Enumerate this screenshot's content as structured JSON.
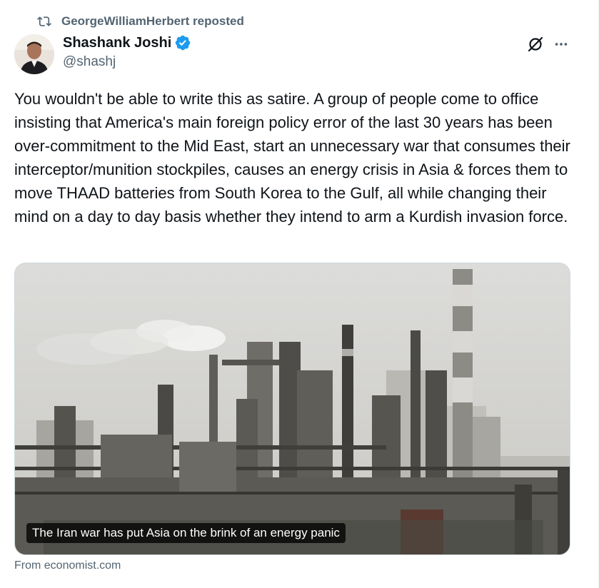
{
  "repost": {
    "label": "GeorgeWilliamHerbert reposted",
    "icon": "repost-icon"
  },
  "author": {
    "name": "Shashank Joshi",
    "handle": "@shashj",
    "verified": true,
    "verified_color": "#1d9bf0"
  },
  "actions": {
    "grok_icon": "grok-icon",
    "more_icon": "more-icon"
  },
  "tweet": {
    "text": "You wouldn't be able to write this as satire. A group of people come to office insisting that America's main foreign policy error of the last 30 years has been over-commitment to the Mid East, start an unnecessary war that consumes their interceptor/munition stockpiles, causes an energy crisis in Asia & forces them to move THAAD batteries from South Korea to the Gulf, all while changing their mind on a day to day basis whether they intend to arm a Kurdish invasion force."
  },
  "card": {
    "image_alt": "Industrial refinery with smokestacks",
    "caption": "The Iran war has put Asia on the brink of an energy panic",
    "source": "From economist.com"
  },
  "colors": {
    "text": "#0f1419",
    "secondary": "#536471",
    "accent": "#1d9bf0"
  }
}
